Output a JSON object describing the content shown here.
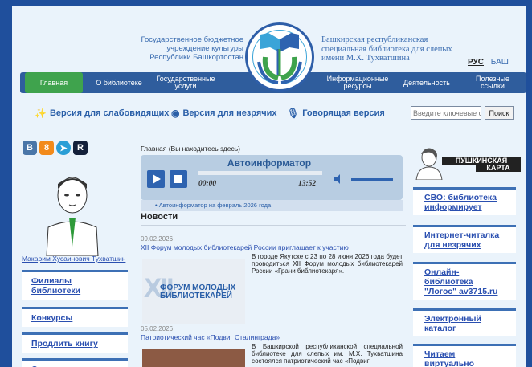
{
  "header": {
    "org_left": [
      "Государственное бюджетное",
      "учреждение культуры",
      "Республики Башкортостан"
    ],
    "org_right": [
      "Башкирская республиканская",
      "специальная библиотека для слепых",
      "имени М.Х. Тухватшина"
    ],
    "lang_ru": "РУС",
    "lang_ba": "БАШ"
  },
  "nav": {
    "items": [
      {
        "label": "Главная",
        "active": true
      },
      {
        "label": "О библиотеке"
      },
      {
        "label": "Государственные услуги"
      },
      {
        "label": "Информационные ресурсы"
      },
      {
        "label": "Деятельность"
      },
      {
        "label": "Полезные ссылки"
      }
    ]
  },
  "accessibility": {
    "low_vision": "Версия для слабовидящих",
    "blind": "Версия для незрячих",
    "voice": "Говорящая версия"
  },
  "search": {
    "placeholder": "Введите ключевые с",
    "button": "Поиск"
  },
  "social": {
    "icons": [
      "vk-icon",
      "odnoklassniki-icon",
      "telegram-icon",
      "rutube-icon"
    ],
    "letters": [
      "B",
      "8",
      "➤",
      "R"
    ]
  },
  "portrait": {
    "caption": "Макарим Хусаинович Тухватшин"
  },
  "left_links": [
    "Филиалы библиотеки",
    "Конкурсы",
    "Продлить книгу",
    "Справк..."
  ],
  "breadcrumb": "Главная (Вы находитесь здесь)",
  "player": {
    "title": "Автоинформатор",
    "current_time": "00:00",
    "duration": "13:52",
    "playlist_item": "Автоинформатор на февраль 2026 года"
  },
  "news": {
    "heading": "Новости",
    "items": [
      {
        "date": "09.02.2026",
        "title": "XII Форум молодых библиотекарей России приглашает к участию",
        "text": "В городе Якутске с 23 по 28 июня 2026 года будет проводиться XII Форум молодых библиотекарей России «Грани библиотекаря».",
        "image_text": [
          "ФОРУМ МОЛОДЫХ",
          "БИБЛИОТЕКАРЕЙ"
        ],
        "image_mark": "XII"
      },
      {
        "date": "05.02.2026",
        "title": "Патриотический час «Подвиг Сталинграда»",
        "text": "В Башкирской республиканской специальной библиотеке для слепых им. М.Х. Тухватшина состоялся патриотический час «Подвиг"
      }
    ]
  },
  "right": {
    "banner_text": [
      "ПУШКИНСКАЯ",
      "КАРТА"
    ],
    "links": [
      "СВО: библиотека информирует",
      "Интернет-читалка для незрячих",
      "Онлайн-библиотека \"Логос\" av3715.ru",
      "Электронный каталог",
      "Читаем виртуально"
    ]
  },
  "colors": {
    "brand_blue": "#2f5d9d",
    "active_green": "#3fa34d",
    "page_bg": "#eaf3fb",
    "link": "#2a4fb0"
  }
}
